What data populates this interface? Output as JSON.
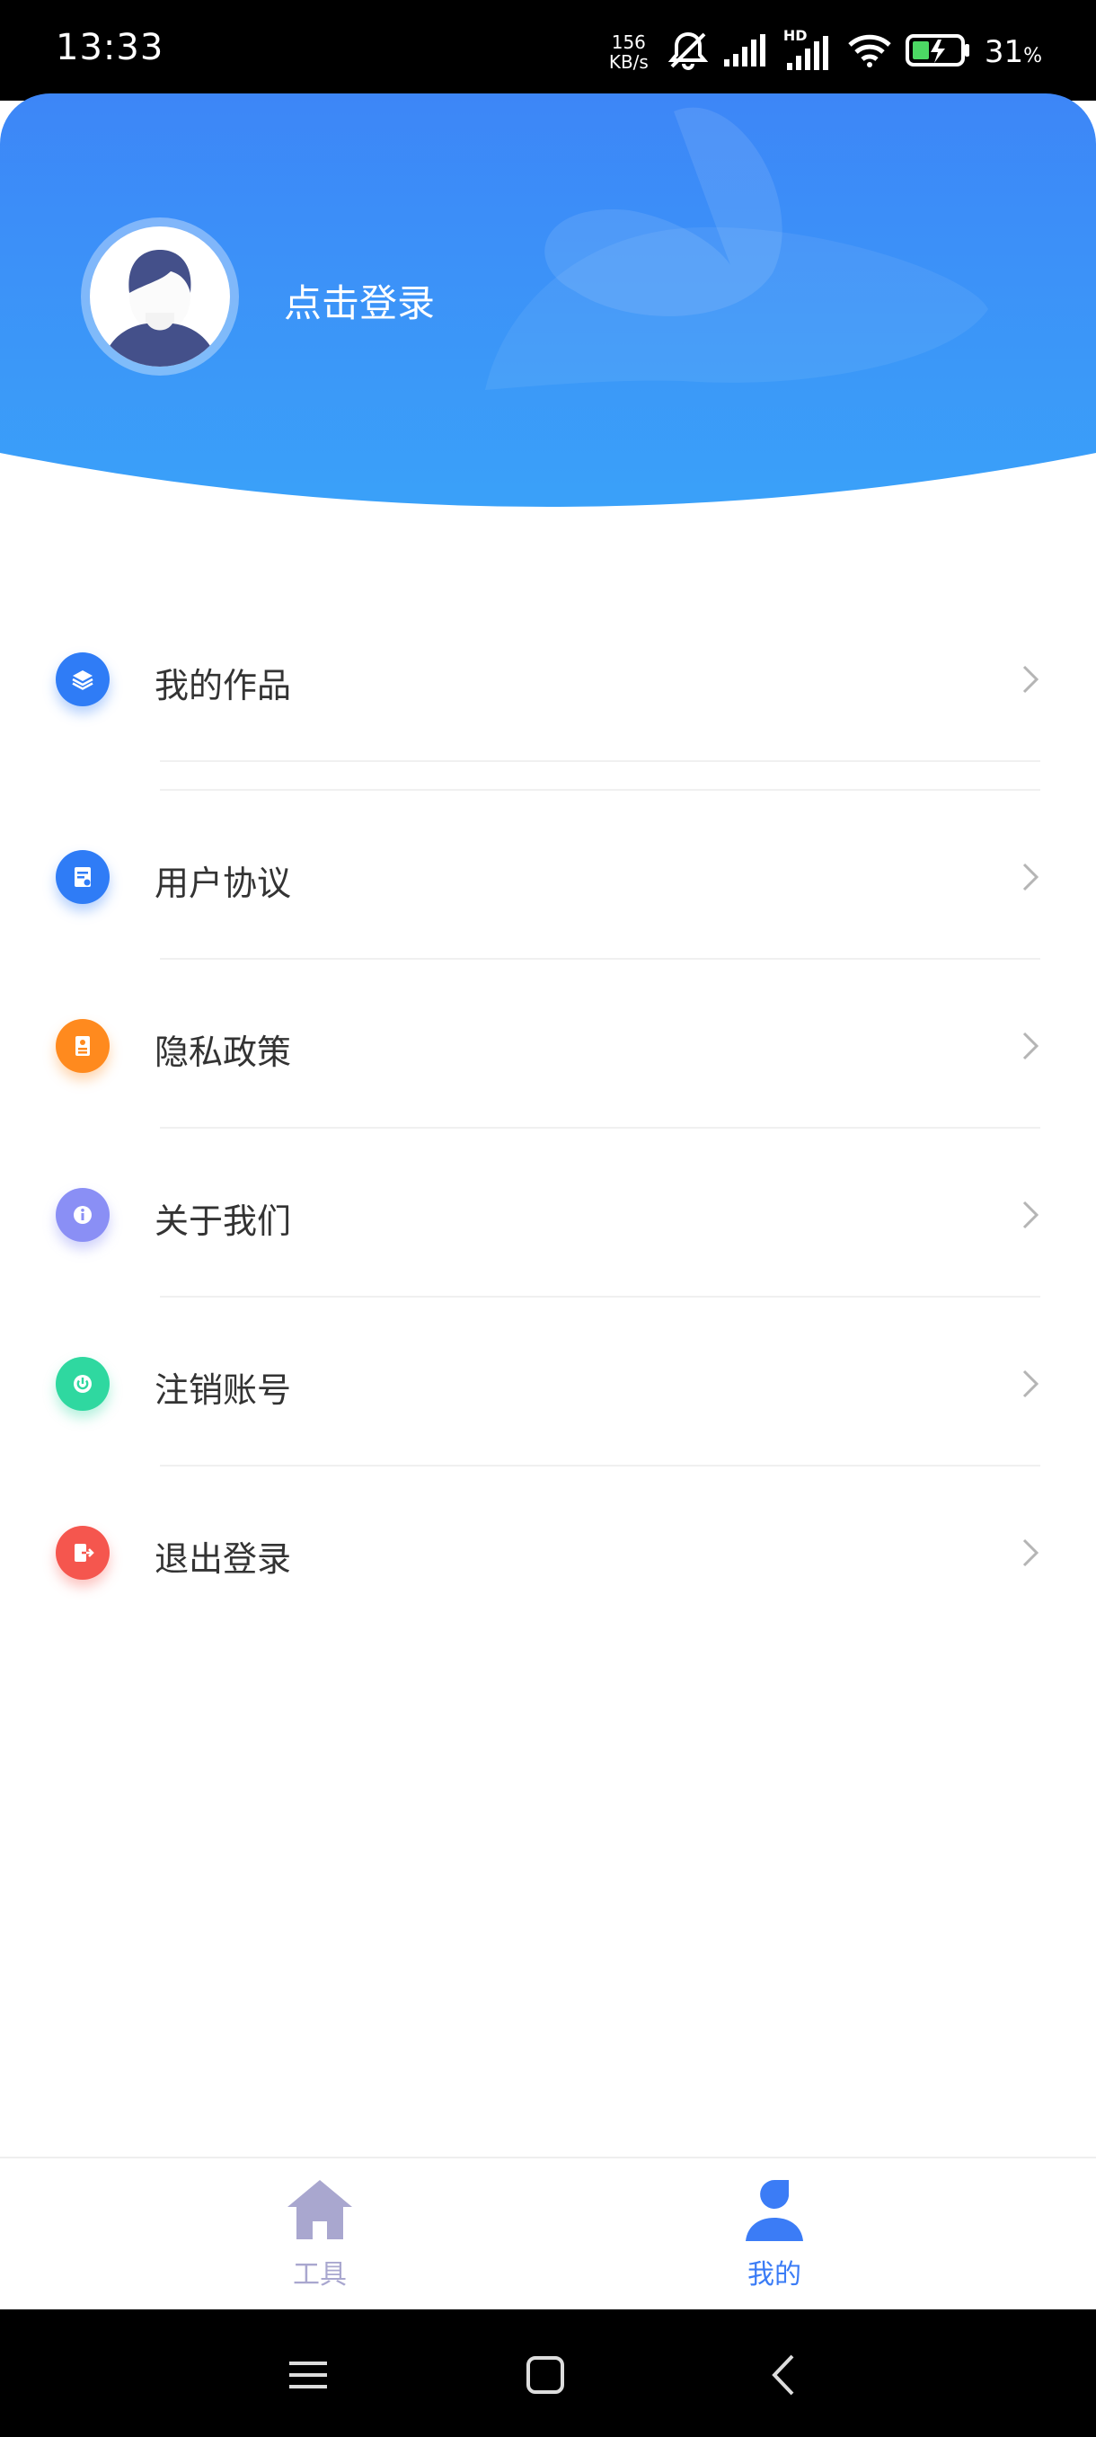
{
  "status_bar": {
    "time": "13:33",
    "net_speed_value": "156",
    "net_speed_unit": "KB/s",
    "hd_label": "HD",
    "battery_percent": "31",
    "battery_percent_sign": "%"
  },
  "header": {
    "login_label": "点击登录",
    "gradient_top": "#3d86f7",
    "gradient_bottom": "#3aa1f9"
  },
  "menu": {
    "items": [
      {
        "label": "我的作品",
        "icon": "layers-icon",
        "color": "#2f7cf6"
      },
      {
        "label": "用户协议",
        "icon": "document-icon",
        "color": "#2f7cf6"
      },
      {
        "label": "隐私政策",
        "icon": "contact-card-icon",
        "color": "#ff8a1e"
      },
      {
        "label": "关于我们",
        "icon": "info-icon",
        "color": "#8a8ff5"
      },
      {
        "label": "注销账号",
        "icon": "power-icon",
        "color": "#2fd8a0"
      },
      {
        "label": "退出登录",
        "icon": "logout-icon",
        "color": "#f5564e"
      }
    ]
  },
  "tabbar": {
    "tools_label": "工具",
    "mine_label": "我的",
    "active_color": "#3b7cf6",
    "inactive_color": "#a9a7cf"
  }
}
